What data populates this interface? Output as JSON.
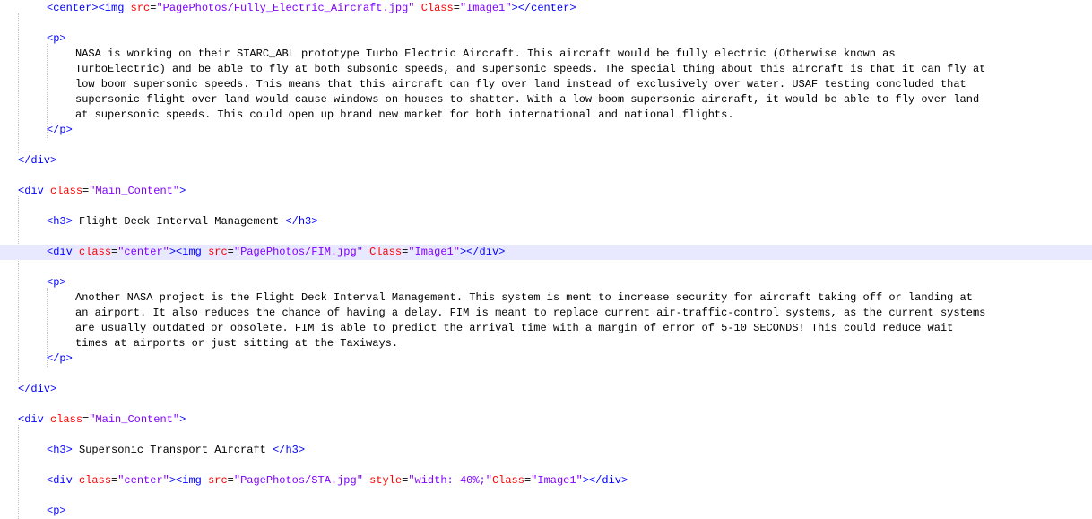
{
  "lines": [
    [
      [
        "t",
        "<center><img "
      ],
      [
        "a",
        "src"
      ],
      [
        "o",
        "="
      ],
      [
        "v",
        "\"PagePhotos/Fully_Electric_Aircraft.jpg\""
      ],
      [
        "x",
        " "
      ],
      [
        "a",
        "Class"
      ],
      [
        "o",
        "="
      ],
      [
        "v",
        "\"Image1\""
      ],
      [
        "t",
        "></center>"
      ]
    ],
    [],
    [
      [
        "t",
        "<p>"
      ]
    ],
    [
      [
        "x",
        "NASA is working on their STARC_ABL prototype Turbo Electric Aircraft. This aircraft would be fully electric (Otherwise known as"
      ]
    ],
    [
      [
        "x",
        "TurboElectric) and be able to fly at both subsonic speeds, and supersonic speeds. The special thing about this aircraft is that it can fly at"
      ]
    ],
    [
      [
        "x",
        "low boom supersonic speeds. This means that this aircraft can fly over land instead of exclusively over water. USAF testing concluded that"
      ]
    ],
    [
      [
        "x",
        "supersonic flight over land would cause windows on houses to shatter. With a low boom supersonic aircraft, it would be able to fly over land"
      ]
    ],
    [
      [
        "x",
        "at supersonic speeds. This could open up brand new market for both international and national flights."
      ]
    ],
    [
      [
        "t",
        "</p>"
      ]
    ],
    [],
    [
      [
        "t",
        "</div>"
      ]
    ],
    [],
    [
      [
        "t",
        "<div "
      ],
      [
        "a",
        "class"
      ],
      [
        "o",
        "="
      ],
      [
        "v",
        "\"Main_Content\""
      ],
      [
        "t",
        ">"
      ]
    ],
    [],
    [
      [
        "t",
        "<h3>"
      ],
      [
        "x",
        " Flight Deck Interval Management "
      ],
      [
        "t",
        "</h3>"
      ]
    ],
    [],
    [
      [
        "t",
        "<div "
      ],
      [
        "a",
        "class"
      ],
      [
        "o",
        "="
      ],
      [
        "v",
        "\"center\""
      ],
      [
        "t",
        "><img "
      ],
      [
        "a",
        "src"
      ],
      [
        "o",
        "="
      ],
      [
        "v",
        "\"PagePhotos/FIM.jpg\""
      ],
      [
        "x",
        " "
      ],
      [
        "a",
        "Class"
      ],
      [
        "o",
        "="
      ],
      [
        "v",
        "\"Image1\""
      ],
      [
        "t",
        "></div>"
      ]
    ],
    [],
    [
      [
        "t",
        "<p>"
      ]
    ],
    [
      [
        "x",
        "Another NASA project is the Flight Deck Interval Management. This system is ment to increase security for aircraft taking off or landing at"
      ]
    ],
    [
      [
        "x",
        "an airport. It also reduces the chance of having a delay. FIM is meant to replace current air-traffic-control systems, as the current systems"
      ]
    ],
    [
      [
        "x",
        "are usually outdated or obsolete. FIM is able to predict the arrival time with a margin of error of 5-10 SECONDS! This could reduce wait"
      ]
    ],
    [
      [
        "x",
        "times at airports or just sitting at the Taxiways."
      ]
    ],
    [
      [
        "t",
        "</p>"
      ]
    ],
    [],
    [
      [
        "t",
        "</div>"
      ]
    ],
    [],
    [
      [
        "t",
        "<div "
      ],
      [
        "a",
        "class"
      ],
      [
        "o",
        "="
      ],
      [
        "v",
        "\"Main_Content\""
      ],
      [
        "t",
        ">"
      ]
    ],
    [],
    [
      [
        "t",
        "<h3>"
      ],
      [
        "x",
        " Supersonic Transport Aircraft "
      ],
      [
        "t",
        "</h3>"
      ]
    ],
    [],
    [
      [
        "t",
        "<div "
      ],
      [
        "a",
        "class"
      ],
      [
        "o",
        "="
      ],
      [
        "v",
        "\"center\""
      ],
      [
        "t",
        "><img "
      ],
      [
        "a",
        "src"
      ],
      [
        "o",
        "="
      ],
      [
        "v",
        "\"PagePhotos/STA.jpg\""
      ],
      [
        "x",
        " "
      ],
      [
        "a",
        "style"
      ],
      [
        "o",
        "="
      ],
      [
        "v",
        "\"width: 40%;\""
      ],
      [
        "a",
        "Class"
      ],
      [
        "o",
        "="
      ],
      [
        "v",
        "\"Image1\""
      ],
      [
        "t",
        "></div>"
      ]
    ],
    [],
    [
      [
        "t",
        "<p>"
      ]
    ]
  ],
  "current_line": 16,
  "colors": {
    "tag": "#0000ff",
    "attribute": "#ff0000",
    "value": "#8000ff",
    "text": "#000000",
    "current_line_bg": "#e8e8ff",
    "indent_guide": "#c0c0c0"
  }
}
